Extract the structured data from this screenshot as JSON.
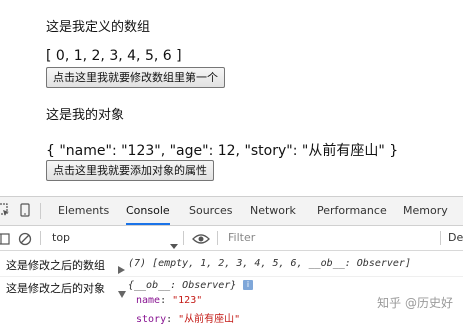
{
  "page": {
    "array_heading": "这是我定义的数组",
    "array_value": "[ 0, 1, 2, 3, 4, 5, 6 ]",
    "array_button": "点击这里我就要修改数组里第一个",
    "object_heading": "这是我的对象",
    "object_value": "{ \"name\": \"123\", \"age\": 12, \"story\": \"从前有座山\" }",
    "object_button": "点击这里我就要添加对象的属性"
  },
  "devtools": {
    "tabs": [
      "Elements",
      "Console",
      "Sources",
      "Network",
      "Performance",
      "Memory"
    ],
    "active_tab": "Console",
    "context": "top",
    "filter_placeholder": "Filter",
    "levels_label": "De",
    "accent": "#1a73e8",
    "icons": [
      "inspect-icon",
      "device-toolbar-icon",
      "sidebar-icon",
      "clear-console-icon",
      "eye-icon"
    ]
  },
  "console": {
    "row1_label": "这是修改之后的数组",
    "row1_value": "(7) [empty, 1, 2, 3, 4, 5, 6, __ob__: Observer]",
    "row2_label": "这是修改之后的对象",
    "row2_value": "{__ob__: Observer}",
    "row2_name_key": "name",
    "row2_name_val": "\"123\"",
    "row2_story_key": "story",
    "row2_story_val": "\"从前有座山\""
  },
  "watermark": "知乎 @历史好"
}
